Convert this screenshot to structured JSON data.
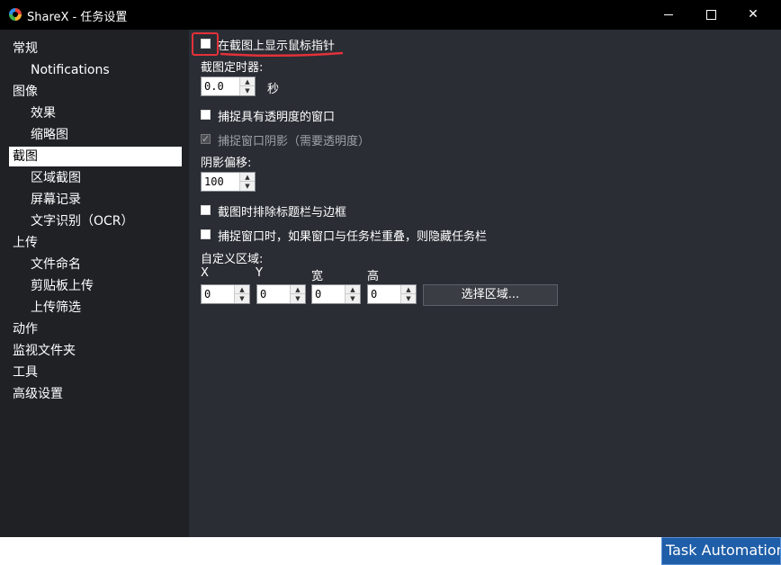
{
  "window": {
    "title": "ShareX - 任务设置"
  },
  "sidebar": {
    "items": [
      {
        "label": "常规"
      },
      {
        "label": "Notifications"
      },
      {
        "label": "图像"
      },
      {
        "label": "效果"
      },
      {
        "label": "缩略图"
      },
      {
        "label": "截图"
      },
      {
        "label": "区域截图"
      },
      {
        "label": "屏幕记录"
      },
      {
        "label": "文字识别（OCR）"
      },
      {
        "label": "上传"
      },
      {
        "label": "文件命名"
      },
      {
        "label": "剪贴板上传"
      },
      {
        "label": "上传筛选"
      },
      {
        "label": "动作"
      },
      {
        "label": "监视文件夹"
      },
      {
        "label": "工具"
      },
      {
        "label": "高级设置"
      }
    ],
    "selected": "截图"
  },
  "capture": {
    "show_cursor_label": "在截图上显示鼠标指针",
    "show_cursor_checked": false,
    "timer_label": "截图定时器:",
    "timer_value": "0.0",
    "timer_unit": "秒",
    "transparent_label": "捕捉具有透明度的窗口",
    "transparent_checked": false,
    "shadow_label": "捕捉窗口阴影（需要透明度）",
    "shadow_checked": true,
    "shadow_offset_label": "阴影偏移:",
    "shadow_offset_value": "100",
    "exclude_titlebar_label": "截图时排除标题栏与边框",
    "exclude_titlebar_checked": false,
    "hide_taskbar_label": "捕捉窗口时，如果窗口与任务栏重叠，则隐藏任务栏",
    "hide_taskbar_checked": false,
    "custom_region_label": "自定义区域:",
    "region": {
      "x_label": "X",
      "x_value": "0",
      "y_label": "Y",
      "y_value": "0",
      "w_label": "宽",
      "w_value": "0",
      "h_label": "高",
      "h_value": "0"
    },
    "select_region_button": "选择区域..."
  },
  "watermark": {
    "text": "Task Automation @迪菇奇科普"
  },
  "colors": {
    "annotation": "#e2323a",
    "sidebar_bg": "#1f2125",
    "content_bg": "#2a2d34"
  }
}
